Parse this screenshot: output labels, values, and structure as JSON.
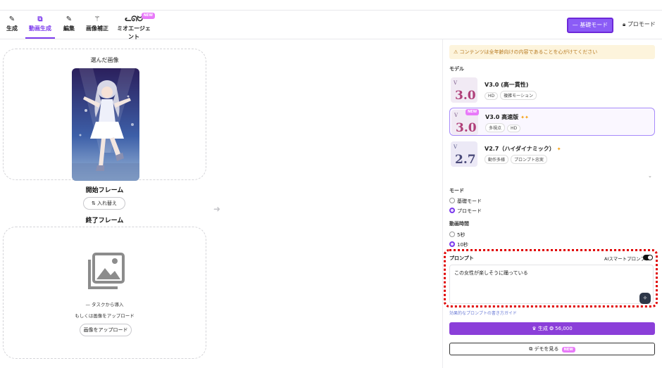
{
  "toolbar": {
    "tabs": [
      {
        "label": "生成",
        "icon": "pencil-icon"
      },
      {
        "label": "動画生成",
        "icon": "video-edit-icon"
      },
      {
        "label": "編集",
        "icon": "pen-icon"
      },
      {
        "label": "画像補正",
        "icon": "magic-wand-icon"
      },
      {
        "label": "ミオエージェント",
        "icon": "cat-robot-icon",
        "badge": "NEW"
      }
    ],
    "active_tab": "動画生成",
    "basic_mode_label": "— 基礎モード",
    "pro_mode_label": "プロモード"
  },
  "left": {
    "selected_image_label": "選んだ画像",
    "start_frame_label": "開始フレーム",
    "swap_label": "入れ替え",
    "end_frame_label": "終了フレーム",
    "import_from_task": "— タスクから導入",
    "or_upload": "もしくは画像をアップロード",
    "upload_button": "画像をアップロード"
  },
  "right": {
    "warning": "コンテンツは全年齢向けの内容であることを心がけてください",
    "model_label": "モデル",
    "models": [
      {
        "logo": "3.0",
        "name": "V3.0 (高一貫性)",
        "tags": [
          "HD",
          "複雑モーション"
        ],
        "sparkles": "",
        "selected": false
      },
      {
        "logo": "3.0",
        "name": "V3.0 高速版",
        "tags": [
          "多視点",
          "HD"
        ],
        "sparkles": "✦✦",
        "badge": "NEW",
        "selected": true
      },
      {
        "logo": "2.7",
        "name": "V2.7（ハイダイナミック）",
        "tags": [
          "動作多様",
          "プロンプト忠実"
        ],
        "sparkles": "✦",
        "selected": false
      }
    ],
    "mode_label": "モード",
    "modes": [
      {
        "label": "基礎モード",
        "checked": false
      },
      {
        "label": "プロモード",
        "checked": true
      }
    ],
    "duration_label": "動画時間",
    "durations": [
      {
        "label": "5秒",
        "checked": false
      },
      {
        "label": "10秒",
        "checked": true
      }
    ],
    "prompt_label": "プロンプト",
    "ai_smart_prompt_label": "AIスマートプロンプト",
    "prompt_text": "この女性が楽しそうに踊っている",
    "prompt_guide_link": "効果的なプロンプトの書き方ガイド",
    "generate_label": "生成",
    "generate_cost": "56,000",
    "demo_label": "デモを見る",
    "demo_badge": "NEW"
  },
  "colors": {
    "accent": "#8b5cf6",
    "highlight_border": "#e00000",
    "warning_bg": "#fdf4dc"
  }
}
